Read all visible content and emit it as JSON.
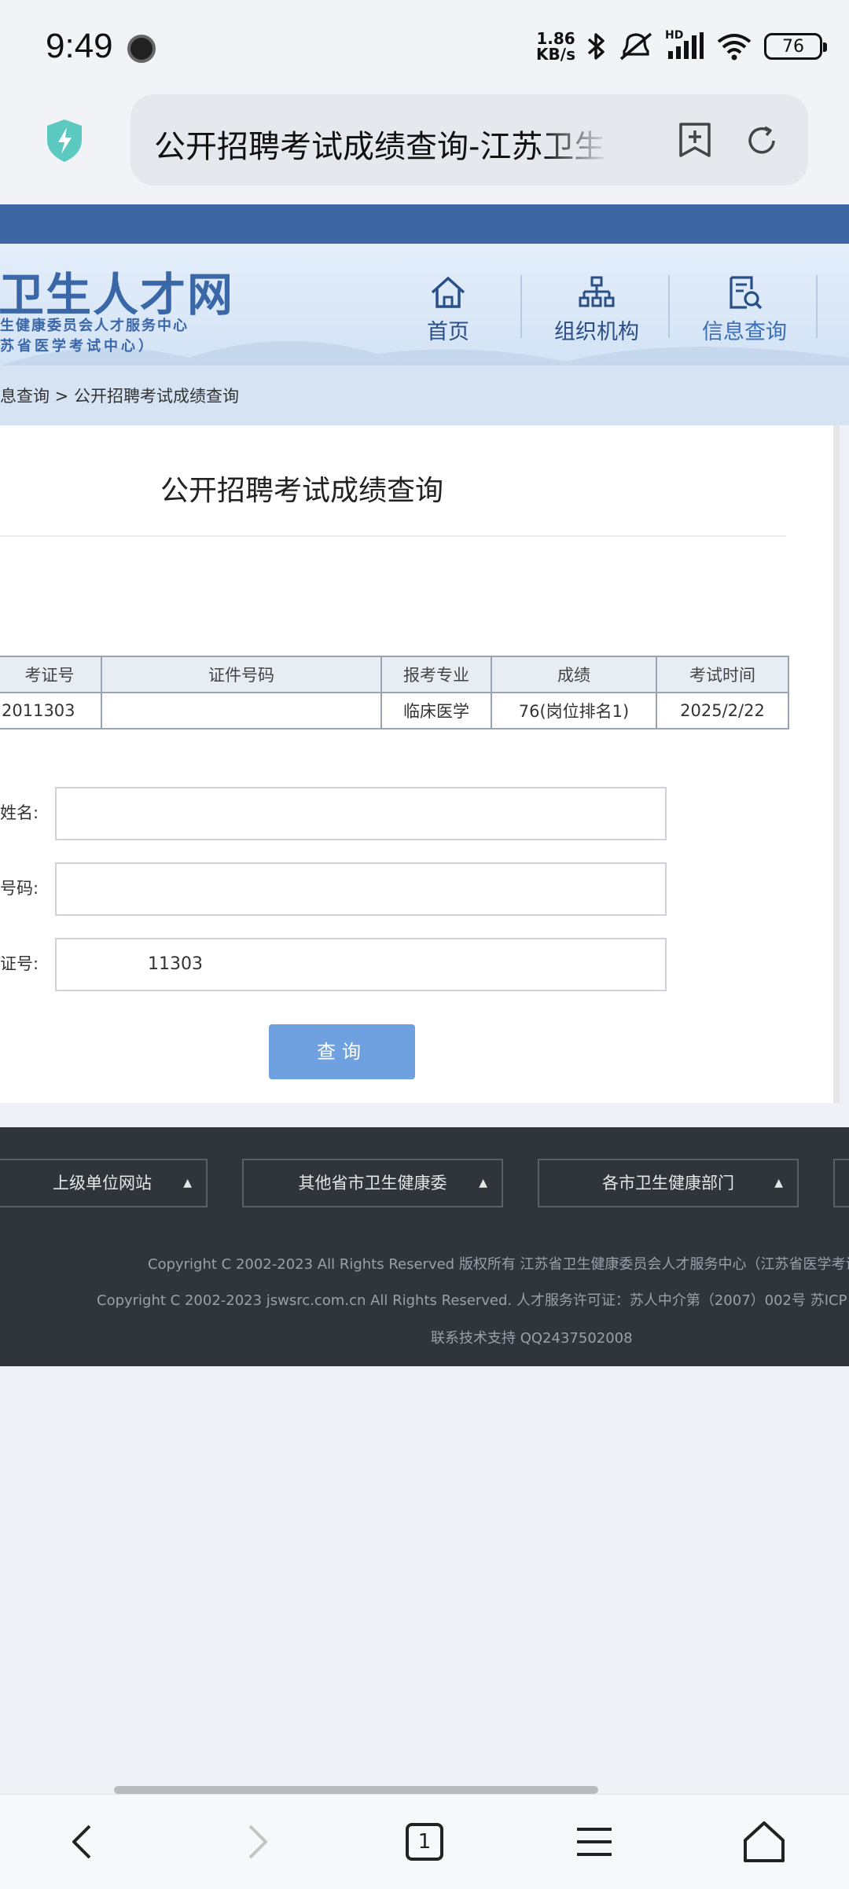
{
  "status_bar": {
    "time": "9:49",
    "net_speed_value": "1.86",
    "net_speed_unit": "KB/s",
    "signal_label": "HD",
    "battery": "76",
    "icons": [
      "bluetooth-icon",
      "mute-icon",
      "signal-icon",
      "wifi-icon",
      "battery-icon"
    ]
  },
  "browser": {
    "url_title": "公开招聘考试成绩查询-江苏卫生",
    "icons": [
      "shield-icon",
      "bookmark-add-icon",
      "reload-icon"
    ]
  },
  "site": {
    "logo_title": "卫生人才网",
    "logo_sub1": "生健康委员会人才服务中心",
    "logo_sub2": "苏省医学考试中心）",
    "nav": [
      {
        "label": "首页",
        "icon": "home-icon"
      },
      {
        "label": "组织机构",
        "icon": "org-chart-icon"
      },
      {
        "label": "信息查询",
        "icon": "search-doc-icon"
      }
    ],
    "breadcrumb": "息查询 > 公开招聘考试成绩查询"
  },
  "main": {
    "title": "公开招聘考试成绩查询",
    "table": {
      "headers": [
        "考证号",
        "证件号码",
        "报考专业",
        "成绩",
        "考试时间"
      ],
      "rows": [
        [
          "2011303",
          "",
          "临床医学",
          "76(岗位排名1)",
          "2025/2/22"
        ]
      ]
    },
    "form": {
      "name_label": "姓名:",
      "id_label": "号码:",
      "ticket_label": "证号:",
      "name_value": "",
      "id_value": "",
      "ticket_value": "11303",
      "submit_label": "查询"
    }
  },
  "footer": {
    "selects": [
      "上级单位网站",
      "其他省市卫生健康委",
      "各市卫生健康部门"
    ],
    "copyright1": "Copyright C 2002-2023 All Rights Reserved 版权所有 江苏省卫生健康委员会人才服务中心（江苏省医学考试",
    "copyright2": "Copyright C 2002-2023 jswsrc.com.cn All Rights Reserved.   人才服务许可证：苏人中介第（2007）002号   苏ICP",
    "support": "联系技术支持 QQ2437502008"
  },
  "bottom_nav": {
    "tab_count": "1",
    "icons": [
      "back-icon",
      "forward-icon",
      "tabs-icon",
      "menu-icon",
      "home-icon"
    ]
  },
  "colors": {
    "brand_blue": "#3f66a4",
    "button_blue": "#6fa0df",
    "footer_bg": "#30353c"
  }
}
